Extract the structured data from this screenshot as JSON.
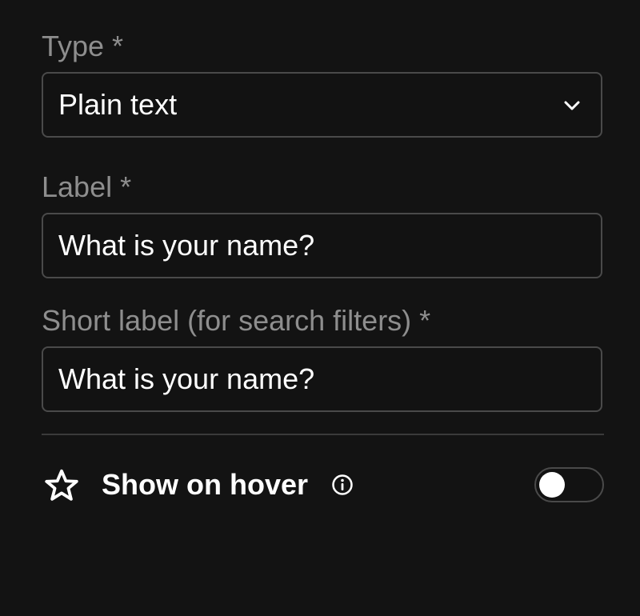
{
  "type_field": {
    "label": "Type *",
    "value": "Plain text",
    "icon": "chevron-down-icon"
  },
  "label_field": {
    "label": "Label *",
    "value": "What is your name?"
  },
  "short_label_field": {
    "label": "Short label (for search filters) *",
    "value": "What is your name?"
  },
  "show_on_hover": {
    "label": "Show on hover",
    "enabled": false,
    "icons": [
      "star-icon",
      "info-icon"
    ]
  },
  "colors": {
    "background": "#131313",
    "border": "#4a4a4a",
    "label_text": "#8e8e8e",
    "value_text": "#ffffff"
  }
}
